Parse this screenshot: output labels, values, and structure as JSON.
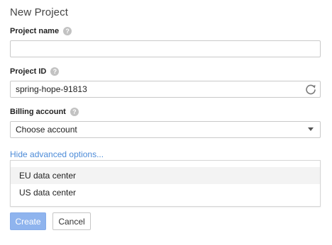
{
  "dialog": {
    "title": "New Project"
  },
  "project_name": {
    "label": "Project name",
    "value": "",
    "help_icon": "question-icon"
  },
  "project_id": {
    "label": "Project ID",
    "value": "spring-hope-91813",
    "help_icon": "question-icon",
    "refresh_icon": "refresh-icon"
  },
  "billing_account": {
    "label": "Billing account",
    "selected": "Choose account",
    "help_icon": "question-icon"
  },
  "advanced": {
    "link_label": "Hide advanced options..."
  },
  "data_center": {
    "options": [
      "EU data center",
      "US data center"
    ]
  },
  "buttons": {
    "create_label": "Create",
    "cancel_label": "Cancel"
  },
  "colors": {
    "link": "#4c8bd8",
    "primary_button": "#8fb4ee"
  }
}
